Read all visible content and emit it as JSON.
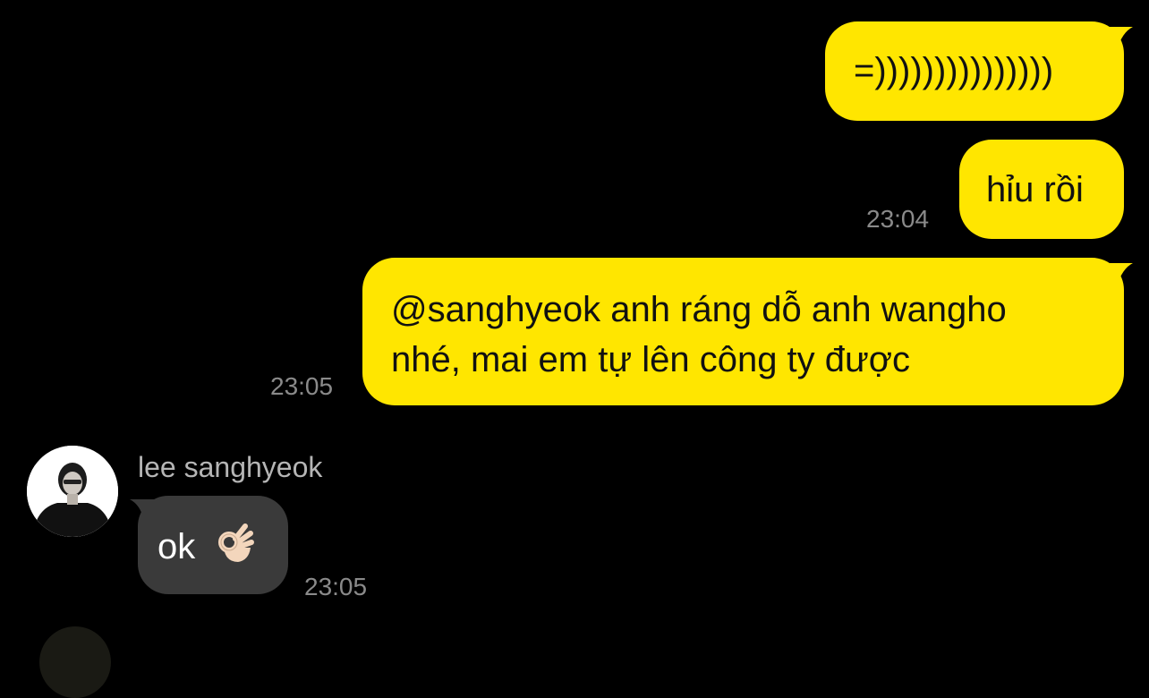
{
  "messages": {
    "m1": {
      "text": "=)))))))))))))))"
    },
    "m2": {
      "text": "hỉu rồi",
      "time": "23:04"
    },
    "m3": {
      "line1": "@sanghyeok anh ráng dỗ anh wangho",
      "line2": "nhé, mai em tự lên công ty được",
      "time": "23:05"
    },
    "m4": {
      "sender": "lee sanghyeok",
      "text": "ok",
      "emoji": "ok-hand-emoji",
      "time": "23:05"
    }
  },
  "colors": {
    "background": "#000000",
    "outgoing_bubble": "#ffe600",
    "incoming_bubble": "#3a3a3a",
    "timestamp": "#8a8a8a",
    "sender_name": "#b5b5b5"
  }
}
